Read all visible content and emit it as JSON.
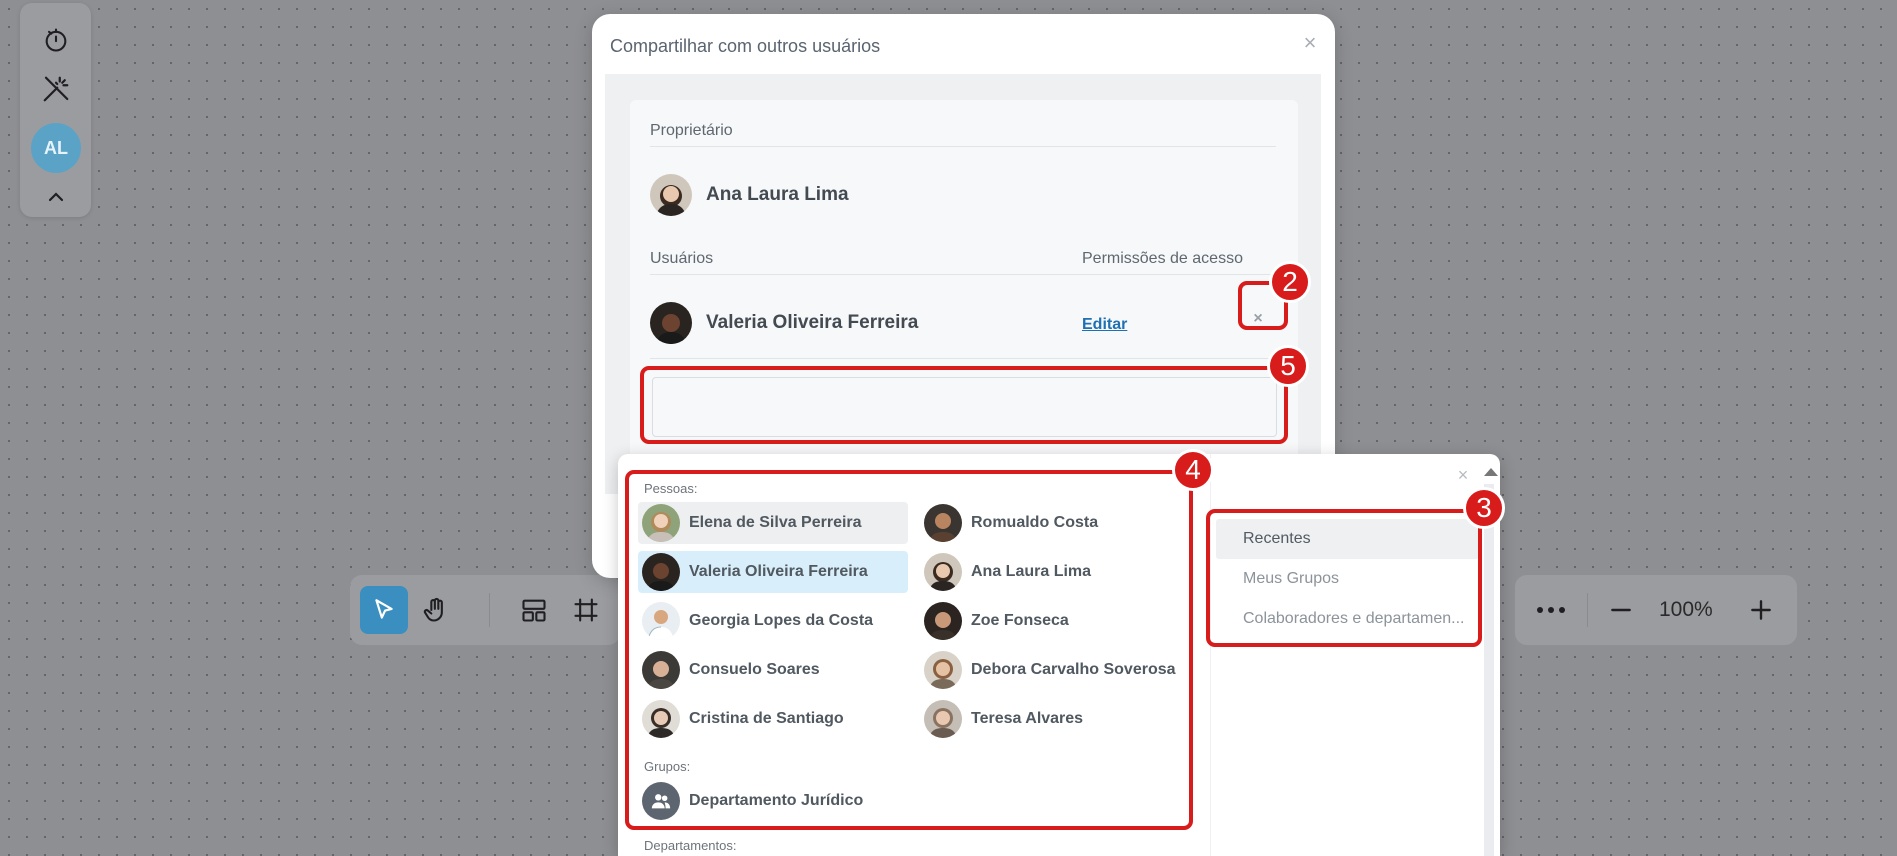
{
  "left_toolbar": {
    "timer_icon": "timer-icon",
    "magic_icon": "magic-wand-off-icon",
    "user_initials": "AL",
    "collapse_icon": "chevron-up-icon"
  },
  "bottom_toolbar": {
    "tools": [
      "pointer-icon",
      "hand-icon",
      "layout-icon",
      "frame-icon"
    ]
  },
  "zoom_toolbar": {
    "zoom_level": "100%"
  },
  "share_dialog": {
    "title": "Compartilhar com outros usuários",
    "owner_label": "Proprietário",
    "owner_name": "Ana Laura Lima",
    "users_label": "Usuários",
    "permissions_label": "Permissões de acesso",
    "shared_user_name": "Valeria Oliveira Ferreira",
    "edit_label": "Editar",
    "search_value": ""
  },
  "picker": {
    "people_label": "Pessoas:",
    "people": [
      {
        "name": "Elena de Silva Perreira",
        "state": "hover"
      },
      {
        "name": "Romualdo Costa",
        "state": ""
      },
      {
        "name": "Valeria Oliveira Ferreira",
        "state": "selected"
      },
      {
        "name": "Ana Laura Lima",
        "state": ""
      },
      {
        "name": "Georgia Lopes da Costa",
        "state": ""
      },
      {
        "name": "Zoe Fonseca",
        "state": ""
      },
      {
        "name": "Consuelo Soares",
        "state": ""
      },
      {
        "name": "Debora Carvalho Soverosa",
        "state": ""
      },
      {
        "name": "Cristina de Santiago",
        "state": ""
      },
      {
        "name": "Teresa Alvares",
        "state": ""
      }
    ],
    "groups_label": "Grupos:",
    "groups": [
      {
        "name": "Departamento Jurídico"
      }
    ],
    "departments_label": "Departamentos:",
    "tabs": [
      {
        "label": "Recentes",
        "active": true
      },
      {
        "label": "Meus Grupos",
        "active": false
      },
      {
        "label": "Colaboradores e departamen...",
        "active": false
      }
    ]
  },
  "annotations": {
    "badge_2": "2",
    "badge_3": "3",
    "badge_4": "4",
    "badge_5": "5",
    "color": "#d81b1b"
  },
  "colors": {
    "accent": "#3a8fc0",
    "link": "#1f6fb3",
    "selected_row": "#d9eefb"
  }
}
